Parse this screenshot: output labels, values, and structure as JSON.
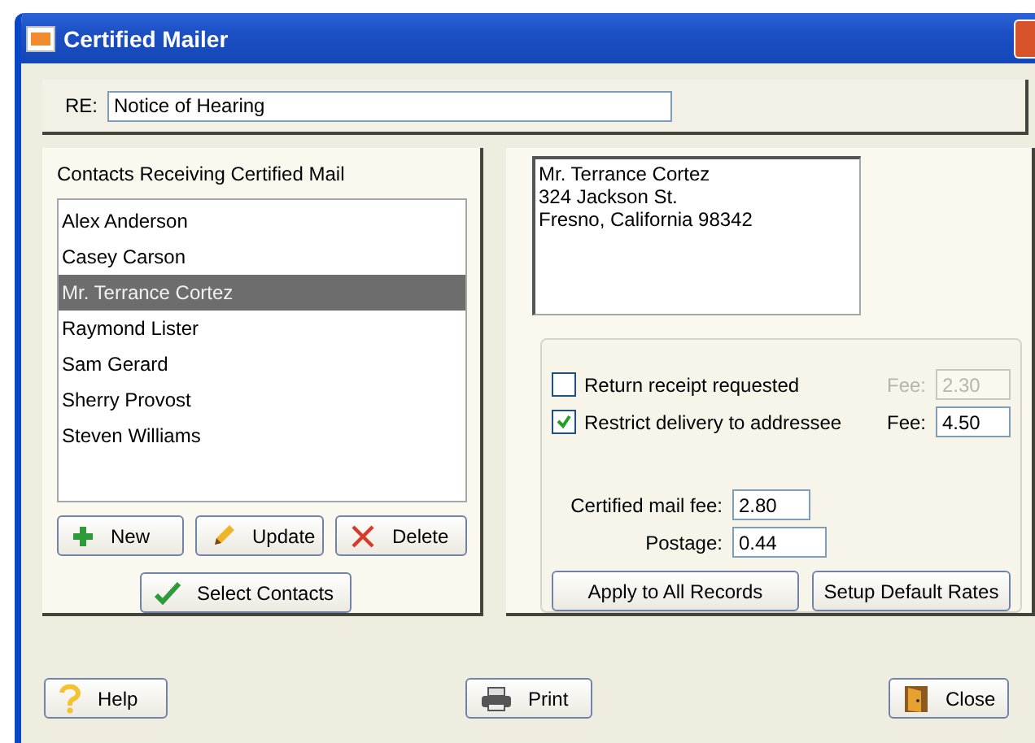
{
  "window": {
    "title": "Certified Mailer"
  },
  "re": {
    "label": "RE:",
    "value": "Notice of Hearing"
  },
  "contacts": {
    "title": "Contacts Receiving Certified Mail",
    "items": [
      {
        "label": "Alex Anderson",
        "selected": false
      },
      {
        "label": "Casey Carson",
        "selected": false
      },
      {
        "label": "Mr. Terrance Cortez",
        "selected": true
      },
      {
        "label": "Raymond Lister",
        "selected": false
      },
      {
        "label": "Sam Gerard",
        "selected": false
      },
      {
        "label": "Sherry Provost",
        "selected": false
      },
      {
        "label": "Steven Williams",
        "selected": false
      }
    ],
    "buttons": [
      {
        "label": "New",
        "kind": "add"
      },
      {
        "label": "Update",
        "kind": "edit"
      },
      {
        "label": "Delete",
        "kind": "delete"
      }
    ],
    "select_button": {
      "label": "Select Contacts",
      "kind": "select"
    }
  },
  "address": {
    "lines": [
      "Mr. Terrance Cortez",
      "324 Jackson St.",
      "Fresno, California  98342"
    ]
  },
  "options": [
    {
      "label": "Return receipt requested",
      "checked": false,
      "fee_label": "Fee:",
      "fee": "2.30",
      "disabled": true
    },
    {
      "label": "Restrict delivery to addressee",
      "checked": true,
      "fee_label": "Fee:",
      "fee": "4.50",
      "disabled": false
    }
  ],
  "fees": [
    {
      "label": "Certified mail fee:",
      "value": "2.80"
    },
    {
      "label": "Postage:",
      "value": "0.44"
    }
  ],
  "option_buttons": [
    "Apply to All Records",
    "Setup Default Rates"
  ],
  "footer_buttons": [
    {
      "label": "Help",
      "kind": "help"
    },
    {
      "label": "Print",
      "kind": "print"
    },
    {
      "label": "Close",
      "kind": "close"
    }
  ]
}
